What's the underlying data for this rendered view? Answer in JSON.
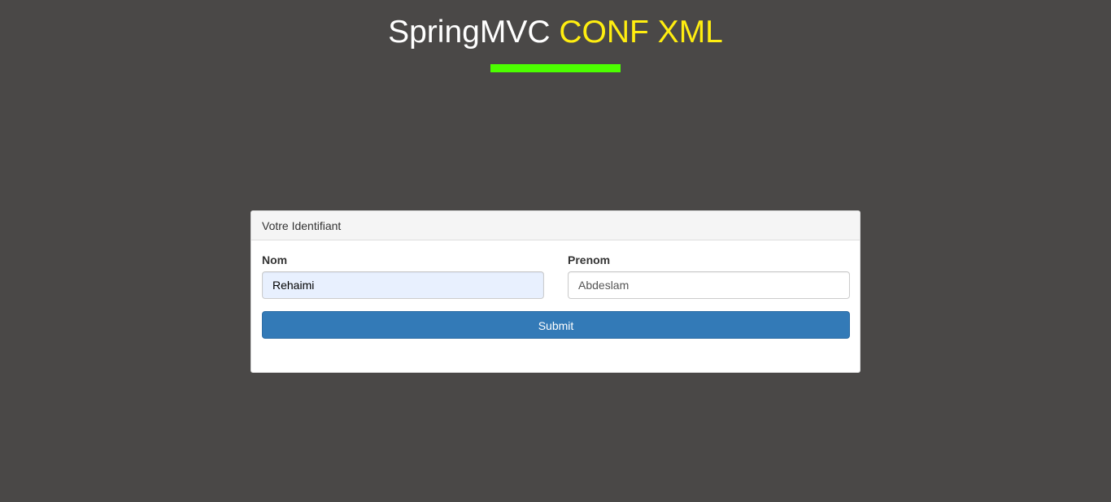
{
  "header": {
    "title_part1": "SpringMVC",
    "title_part2": "CONF XML"
  },
  "colors": {
    "background": "#4a4847",
    "title_white": "#ffffff",
    "title_accent": "#ffee10",
    "underline_bar": "#4cff00",
    "button_primary": "#337ab7",
    "autofill_bg": "#e8f0fe"
  },
  "panel": {
    "heading": "Votre Identifiant",
    "fields": [
      {
        "label": "Nom",
        "value": "Rehaimi"
      },
      {
        "label": "Prenom",
        "value": "Abdeslam"
      }
    ],
    "submit_label": "Submit"
  }
}
